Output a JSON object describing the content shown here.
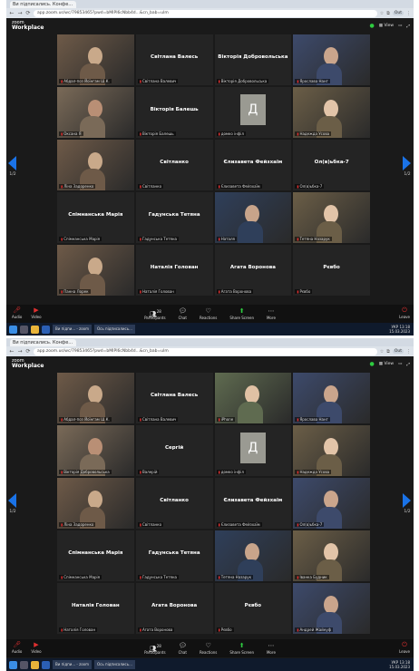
{
  "browser": {
    "tab_label": "Ви підписались. Конфе...",
    "url": "app.zoom.us/wc/79853465?pwd=bMIPI6cNbb4d...&cn_bab=ulm",
    "profile": "Out"
  },
  "zoom": {
    "brand_top": "zoom",
    "brand_bottom": "Workplace",
    "view_label": "View",
    "page_left": "1/2",
    "page_right": "1/2"
  },
  "toolbar": {
    "audio": "Audio",
    "video": "Video",
    "participants": "Participants",
    "participants_count": "28",
    "chat": "Chat",
    "reactions": "Reactions",
    "share_screen": "Share Screen",
    "more": "More",
    "leave": "Leave"
  },
  "taskbar": {
    "app1": "Ви підпи... - zoom",
    "app2": "Ось підписались...",
    "lang": "УКР",
    "time": "13:18",
    "date": "15.03.2023"
  },
  "screen1": {
    "tiles": [
      {
        "label": "Абдал-поз Йоїнгам Ш.К.",
        "big": "",
        "kind": "video",
        "active": true
      },
      {
        "label": "Світлана Валевич",
        "big": "Світлана Валесь",
        "kind": "name"
      },
      {
        "label": "Вікторія Добровольська",
        "big": "Вікторія Добровольська",
        "kind": "name"
      },
      {
        "label": "Ярослава Нанг",
        "big": "",
        "kind": "video"
      },
      {
        "label": "Оксана Я",
        "big": "",
        "kind": "video"
      },
      {
        "label": "Вікторія Балешь",
        "big": "Вікторія Балешь",
        "kind": "name"
      },
      {
        "label": "домко інфіл",
        "big": "",
        "kind": "avatar",
        "initial": "Д"
      },
      {
        "label": "Надежда Усова",
        "big": "",
        "kind": "video"
      },
      {
        "label": "Ліна Задоренко",
        "big": "",
        "kind": "video"
      },
      {
        "label": "Світланко",
        "big": "Світланко",
        "kind": "name"
      },
      {
        "label": "Єлизавета Фейзхаїм",
        "big": "Єлизавета Фейзхаїм",
        "kind": "name"
      },
      {
        "label": "Ол(в)ьбка-7",
        "big": "Ол(в)ьбка-7",
        "kind": "name"
      },
      {
        "label": "Спімнанська Марія",
        "big": "Спімнанська Марія",
        "kind": "name"
      },
      {
        "label": "Гадунська Тетяна",
        "big": "Гадунська Тетяна",
        "kind": "name"
      },
      {
        "label": "Наталя",
        "big": "",
        "kind": "video"
      },
      {
        "label": "Тетяна Назарук",
        "big": "",
        "kind": "video"
      },
      {
        "label": "Панна Лорек",
        "big": "",
        "kind": "photo"
      },
      {
        "label": "Наталія Голован",
        "big": "Наталія Голован",
        "kind": "name"
      },
      {
        "label": "Агата Воронова",
        "big": "Агата Воронова",
        "kind": "name"
      },
      {
        "label": "Рєвбо",
        "big": "Рєвбо",
        "kind": "name"
      }
    ]
  },
  "screen2": {
    "tiles": [
      {
        "label": "Абдал-поз Йоїнгам Ш.К.",
        "big": "",
        "kind": "video",
        "active": true
      },
      {
        "label": "Світлана Валевич",
        "big": "Світлана Валесь",
        "kind": "name"
      },
      {
        "label": "iPhone",
        "big": "",
        "kind": "video"
      },
      {
        "label": "Ярослава Нанг",
        "big": "",
        "kind": "video"
      },
      {
        "label": "Вікторія Добровольська",
        "big": "",
        "kind": "video"
      },
      {
        "label": "Валерій",
        "big": "Сергій",
        "kind": "name"
      },
      {
        "label": "домко інфіл",
        "big": "",
        "kind": "avatar",
        "initial": "Д"
      },
      {
        "label": "Надежда Усова",
        "big": "",
        "kind": "video"
      },
      {
        "label": "Ліна Задоренко",
        "big": "",
        "kind": "video"
      },
      {
        "label": "Світланко",
        "big": "Світланко",
        "kind": "name"
      },
      {
        "label": "Єлизавета Фейзхаїм",
        "big": "Єлизавета Фейзхаїм",
        "kind": "name"
      },
      {
        "label": "Ол(в)ьбка-7",
        "big": "",
        "kind": "video"
      },
      {
        "label": "Спімнанська Марія",
        "big": "Спімнанська Марія",
        "kind": "name"
      },
      {
        "label": "Гадунська Тетяна",
        "big": "Гадунська Тетяна",
        "kind": "name"
      },
      {
        "label": "Тетяна Назарук",
        "big": "",
        "kind": "video"
      },
      {
        "label": "Іванка Будник",
        "big": "",
        "kind": "video"
      },
      {
        "label": "Наталія Голован",
        "big": "Наталія Голован",
        "kind": "name"
      },
      {
        "label": "Агата Воронова",
        "big": "Агата Воронова",
        "kind": "name"
      },
      {
        "label": "Рєвбо",
        "big": "Рєвбо",
        "kind": "name"
      },
      {
        "label": "Андрей Жайнуф",
        "big": "",
        "kind": "video"
      }
    ]
  }
}
